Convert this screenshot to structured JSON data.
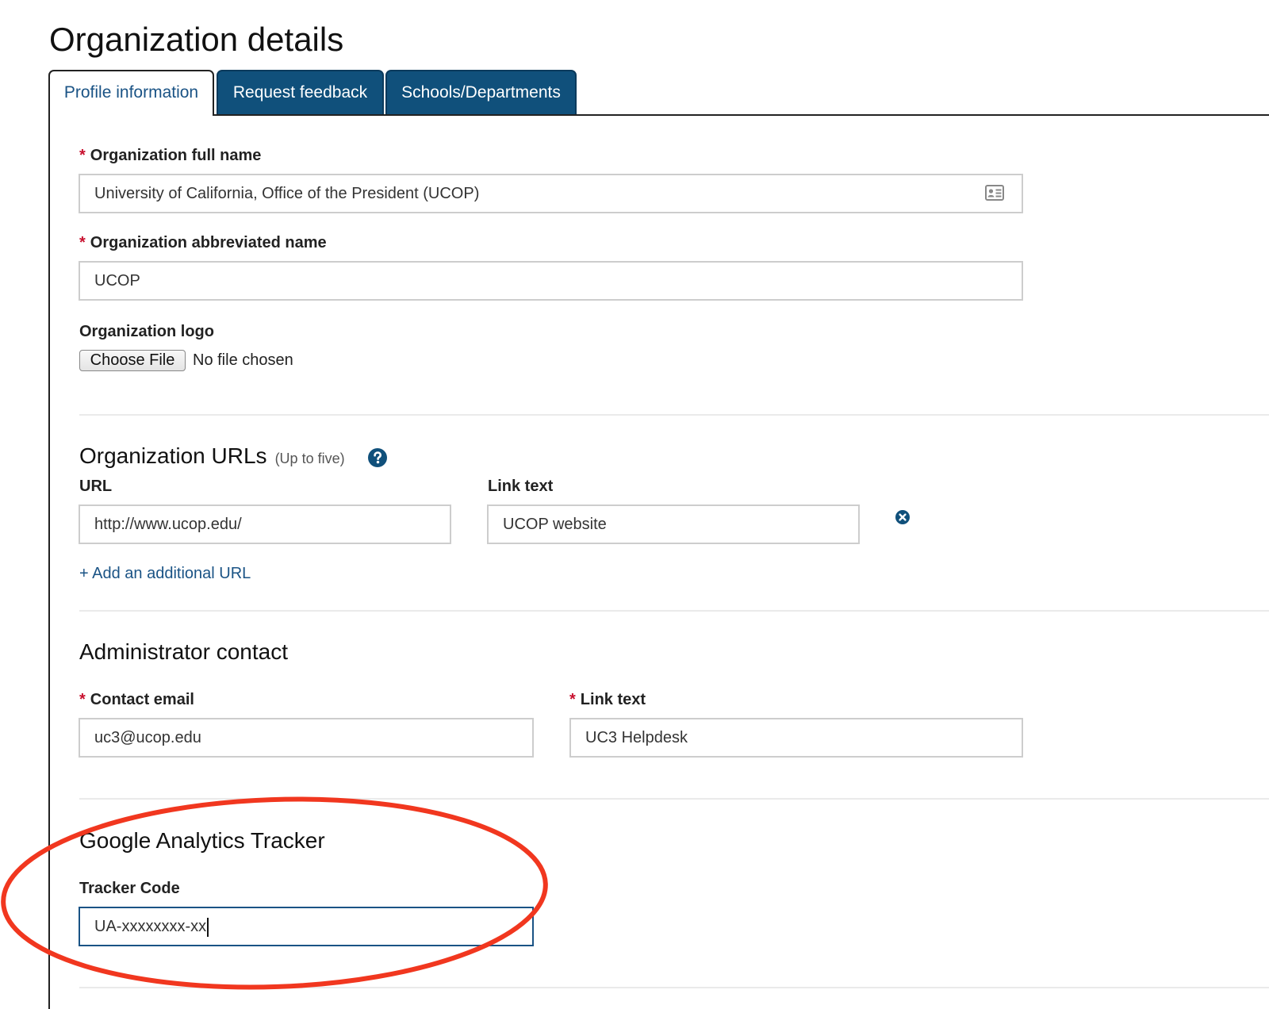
{
  "page": {
    "title": "Organization details"
  },
  "tabs": [
    {
      "label": "Profile information",
      "active": true
    },
    {
      "label": "Request feedback",
      "active": false
    },
    {
      "label": "Schools/Departments",
      "active": false
    }
  ],
  "profile": {
    "full_name": {
      "label": "Organization full name",
      "required": true,
      "value": "University of California, Office of the President (UCOP)",
      "icon": "contact-card-icon"
    },
    "abbreviated_name": {
      "label": "Organization abbreviated name",
      "required": true,
      "value": "UCOP"
    },
    "logo": {
      "label": "Organization logo",
      "button_label": "Choose File",
      "status": "No file chosen"
    }
  },
  "urls": {
    "title": "Organization URLs",
    "subtitle": "(Up to five)",
    "url_label": "URL",
    "link_text_label": "Link text",
    "rows": [
      {
        "url": "http://www.ucop.edu/",
        "link_text": "UCOP website"
      }
    ],
    "add_link": "+ Add an additional URL",
    "help_icon": "question-circle-icon",
    "remove_icon": "remove-circle-icon"
  },
  "admin_contact": {
    "title": "Administrator contact",
    "email": {
      "label": "Contact email",
      "required": true,
      "value": "uc3@ucop.edu"
    },
    "link_text": {
      "label": "Link text",
      "required": true,
      "value": "UC3 Helpdesk"
    }
  },
  "analytics": {
    "title": "Google Analytics Tracker",
    "tracker": {
      "label": "Tracker Code",
      "value": "UA-xxxxxxxx-xx"
    }
  },
  "colors": {
    "brand_blue": "#10507b",
    "link_blue": "#1a5385",
    "required_red": "#c8102e",
    "annotation_red": "#f1371f"
  }
}
